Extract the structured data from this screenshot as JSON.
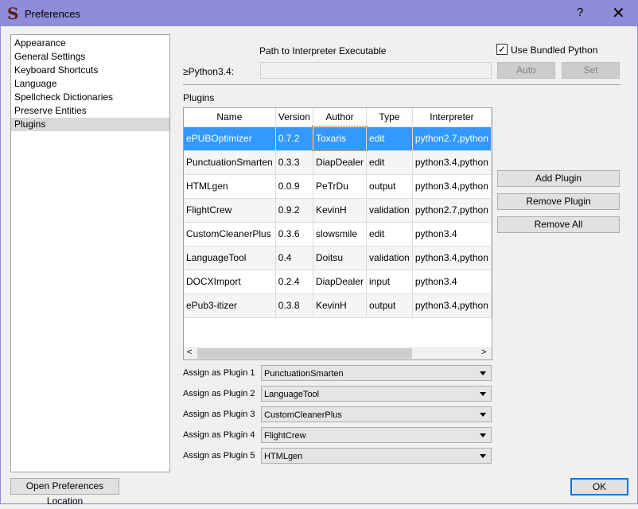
{
  "window": {
    "title": "Preferences",
    "help": "?",
    "close": "✕"
  },
  "sidebar": {
    "items": [
      {
        "label": "Appearance"
      },
      {
        "label": "General Settings"
      },
      {
        "label": "Keyboard Shortcuts"
      },
      {
        "label": "Language"
      },
      {
        "label": "Spellcheck Dictionaries"
      },
      {
        "label": "Preserve Entities"
      },
      {
        "label": "Plugins",
        "selected": true
      }
    ]
  },
  "interpreter": {
    "path_label": "Path to Interpreter Executable",
    "use_bundled_label": "Use Bundled Python",
    "use_bundled_checked": true,
    "python_label": "≥Python3.4:",
    "path_value": "",
    "auto_label": "Auto",
    "set_label": "Set"
  },
  "plugins": {
    "label": "Plugins",
    "columns": [
      "Name",
      "Version",
      "Author",
      "Type",
      "Interpreter"
    ],
    "rows": [
      [
        "ePUBOptimizer",
        "0.7.2",
        "Toxaris",
        "edit",
        "python2.7,python"
      ],
      [
        "PunctuationSmarten",
        "0.3.3",
        "DiapDealer",
        "edit",
        "python3.4,python"
      ],
      [
        "HTMLgen",
        "0.0.9",
        "PeTrDu",
        "output",
        "python3.4,python"
      ],
      [
        "FlightCrew",
        "0.9.2",
        "KevinH",
        "validation",
        "python2.7,python"
      ],
      [
        "CustomCleanerPlus",
        "0.3.6",
        "slowsmile",
        "edit",
        "python3.4"
      ],
      [
        "LanguageTool",
        "0.4",
        "Doitsu",
        "validation",
        "python3.4,python"
      ],
      [
        "DOCXImport",
        "0.2.4",
        "DiapDealer",
        "input",
        "python3.4"
      ],
      [
        "ePub3-itizer",
        "0.3.8",
        "KevinH",
        "output",
        "python3.4,python"
      ]
    ],
    "add_label": "Add Plugin",
    "remove_label": "Remove Plugin",
    "remove_all_label": "Remove All"
  },
  "assign": [
    {
      "label": "Assign as Plugin 1",
      "value": "PunctuationSmarten"
    },
    {
      "label": "Assign as Plugin 2",
      "value": "LanguageTool"
    },
    {
      "label": "Assign as Plugin 3",
      "value": "CustomCleanerPlus"
    },
    {
      "label": "Assign as Plugin 4",
      "value": "FlightCrew"
    },
    {
      "label": "Assign as Plugin 5",
      "value": "HTMLgen"
    }
  ],
  "footer": {
    "open_location_label": "Open Preferences Location",
    "ok_label": "OK"
  },
  "colors": {
    "titlebar": "#8f8cd8",
    "selection": "#3399ff"
  }
}
